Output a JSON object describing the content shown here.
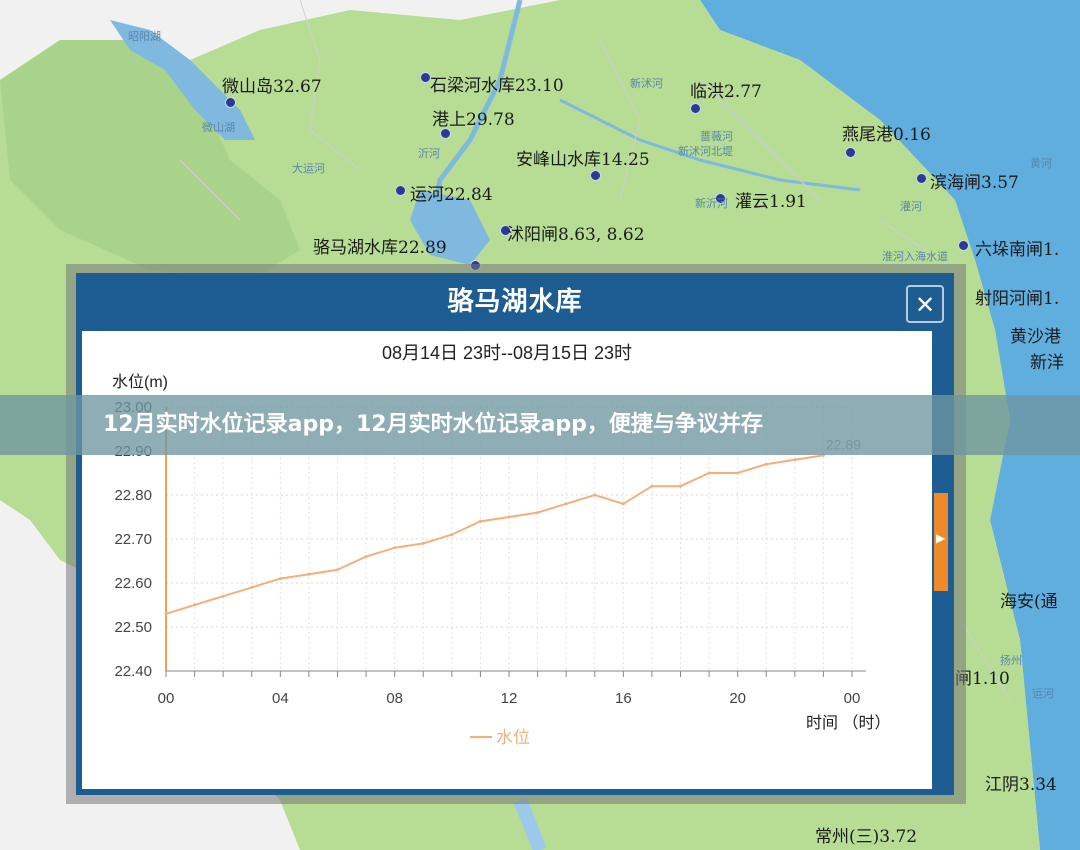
{
  "map": {
    "stations": [
      {
        "label": "微山岛32.67"
      },
      {
        "label": "石梁河水库23.10"
      },
      {
        "label": "临洪2.77"
      },
      {
        "label": "港上29.78"
      },
      {
        "label": "安峰山水库14.25"
      },
      {
        "label": "燕尾港0.16"
      },
      {
        "label": "运河22.84"
      },
      {
        "label": "滨海闸3.57"
      },
      {
        "label": "灌云1.91"
      },
      {
        "label": "沭阳闸8.63, 8.62"
      },
      {
        "label": "骆马湖水库22.89"
      },
      {
        "label": "六垛南闸1."
      },
      {
        "label": "射阳河闸1."
      },
      {
        "label": "黄沙港"
      },
      {
        "label": "新洋"
      },
      {
        "label": "海安(通"
      },
      {
        "label": "闸1.10"
      },
      {
        "label": "江阴3.34"
      },
      {
        "label": "常州(三)3.72"
      }
    ],
    "places": [
      "昭阳湖",
      "微山湖",
      "大运河",
      "沂河",
      "新沭河",
      "蔷薇河",
      "新沭河北堤",
      "新沂河",
      "淮河入海水道",
      "灌河",
      "黄河",
      "扬州",
      "运河"
    ]
  },
  "popup": {
    "title": "骆马湖水库",
    "close_label": "✕"
  },
  "banner": {
    "text": "12月实时水位记录app，12月实时水位记录app，便捷与争议并存"
  },
  "chart_data": {
    "type": "line",
    "title": "08月14日 23时--08月15日 23时",
    "ylabel": "水位(m)",
    "xlabel": "时间 （时）",
    "ylim": [
      22.4,
      23.0
    ],
    "yticks": [
      "22.40",
      "22.50",
      "22.60",
      "22.70",
      "22.80",
      "22.90",
      "23.00"
    ],
    "xticks": [
      "00",
      "04",
      "08",
      "12",
      "16",
      "20",
      "00"
    ],
    "series": [
      {
        "name": "水位",
        "color": "#f3b07a",
        "x": [
          0,
          1,
          2,
          3,
          4,
          5,
          6,
          7,
          8,
          9,
          10,
          11,
          12,
          13,
          14,
          15,
          16,
          17,
          18,
          19,
          20,
          21,
          22,
          23,
          24
        ],
        "values": [
          22.53,
          22.55,
          22.57,
          22.59,
          22.61,
          22.62,
          22.63,
          22.66,
          22.68,
          22.69,
          22.71,
          22.74,
          22.75,
          22.76,
          22.78,
          22.8,
          22.78,
          22.82,
          22.82,
          22.85,
          22.85,
          22.87,
          22.88,
          22.89,
          null
        ]
      }
    ],
    "data_labels": [
      {
        "text": "22.89"
      }
    ],
    "legend": "bottom"
  }
}
